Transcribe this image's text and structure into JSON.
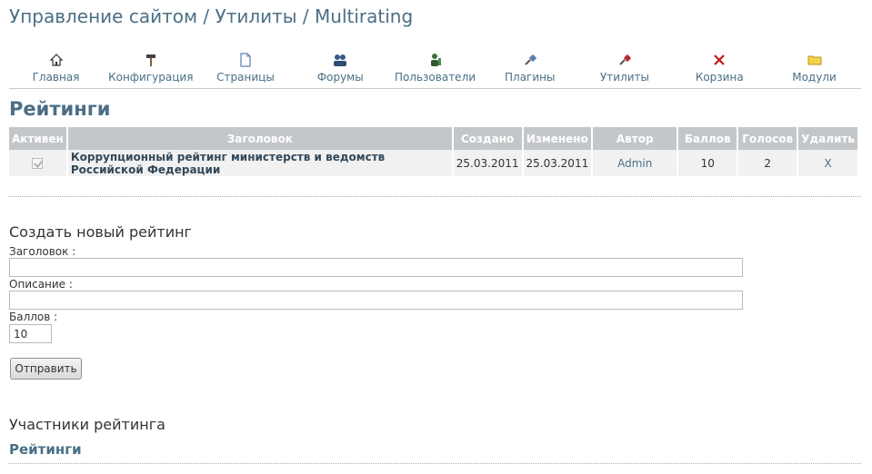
{
  "breadcrumb": "Управление сайтом / Утилиты / Multirating",
  "toolbar": [
    {
      "label": "Главная",
      "icon": "home-icon"
    },
    {
      "label": "Конфигурация",
      "icon": "hammer-icon"
    },
    {
      "label": "Страницы",
      "icon": "page-icon"
    },
    {
      "label": "Форумы",
      "icon": "users-group-icon"
    },
    {
      "label": "Пользователи",
      "icon": "user-icon"
    },
    {
      "label": "Плагины",
      "icon": "plug-icon"
    },
    {
      "label": "Утилиты",
      "icon": "tools-icon"
    },
    {
      "label": "Корзина",
      "icon": "close-icon"
    },
    {
      "label": "Модули",
      "icon": "folder-icon"
    }
  ],
  "ratings": {
    "title": "Рейтинги",
    "columns": [
      "Активен",
      "Заголовок",
      "Создано",
      "Изменено",
      "Автор",
      "Баллов",
      "Голосов",
      "Удалить"
    ],
    "rows": [
      {
        "active": true,
        "title": "Коррупционный рейтинг министерств и ведомств Российской Федерации",
        "created": "25.03.2011",
        "modified": "25.03.2011",
        "author": "Admin",
        "points": "10",
        "votes": "2",
        "delete": "X"
      }
    ]
  },
  "create_form": {
    "heading": "Создать новый рейтинг",
    "title_label": "Заголовок :",
    "title_value": "",
    "description_label": "Описание :",
    "description_value": "",
    "points_label": "Баллов :",
    "points_value": "10",
    "submit_label": "Отправить"
  },
  "participants": {
    "heading": "Участники рейтинга",
    "subtitle": "Рейтинги"
  },
  "colors": {
    "accent": "#4a6f86",
    "table_header": "#c3c7ca",
    "row_bg": "#f1f1f1"
  }
}
